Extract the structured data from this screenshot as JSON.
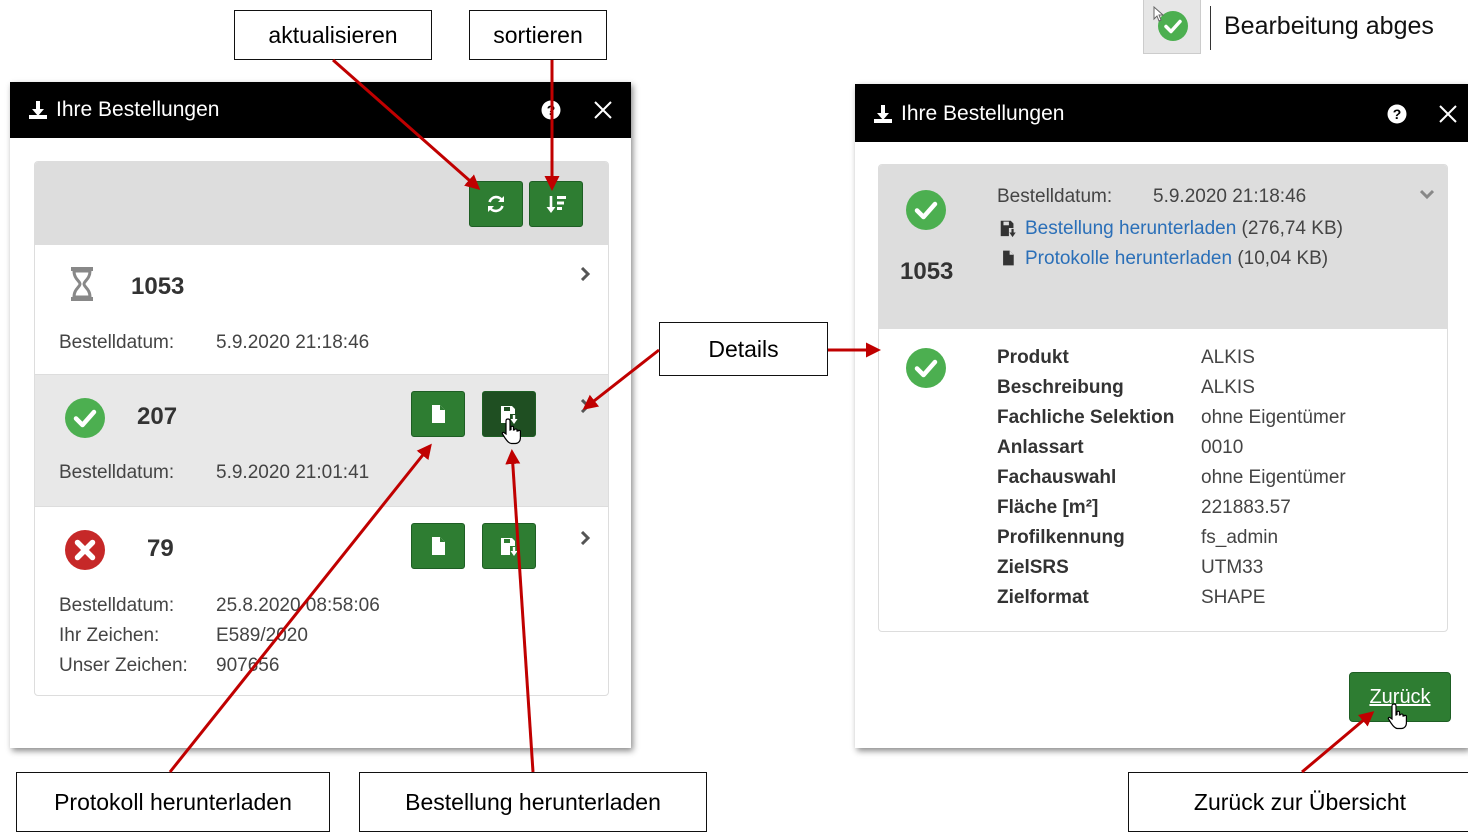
{
  "callouts": {
    "refresh": "aktualisieren",
    "sort": "sortieren",
    "details": "Details",
    "protocol": "Protokoll herunterladen",
    "order": "Bestellung herunterladen",
    "back": "Zurück zur Übersicht",
    "status_done": "Bearbeitung abges"
  },
  "left_panel": {
    "title": "Ihre Bestellungen",
    "items": [
      {
        "number": "1053",
        "status": "pending",
        "date_label": "Bestelldatum:",
        "date": "5.9.2020 21:18:46"
      },
      {
        "number": "207",
        "status": "success",
        "date_label": "Bestelldatum:",
        "date": "5.9.2020 21:01:41"
      },
      {
        "number": "79",
        "status": "error",
        "date_label": "Bestelldatum:",
        "date": "25.8.2020 08:58:06",
        "ref_label": "Ihr Zeichen:",
        "ref": "E589/2020",
        "our_ref_label": "Unser Zeichen:",
        "our_ref": "907656"
      }
    ]
  },
  "right_panel": {
    "title": "Ihre Bestellungen",
    "number": "1053",
    "date_label": "Bestelldatum:",
    "date": "5.9.2020 21:18:46",
    "download_order_link": "Bestellung herunterladen",
    "download_order_size": "(276,74 KB)",
    "download_protocol_link": "Protokolle herunterladen",
    "download_protocol_size": "(10,04 KB)",
    "details": [
      {
        "key": "Produkt",
        "value": "ALKIS"
      },
      {
        "key": "Beschreibung",
        "value": "ALKIS"
      },
      {
        "key": "Fachliche Selektion",
        "value": "ohne Eigentümer"
      },
      {
        "key": "Anlassart",
        "value": "0010"
      },
      {
        "key": "Fachauswahl",
        "value": "ohne Eigentümer"
      },
      {
        "key": "Fläche [m²]",
        "value": "221883.57"
      },
      {
        "key": "Profilkennung",
        "value": "fs_admin"
      },
      {
        "key": "ZielSRS",
        "value": "UTM33"
      },
      {
        "key": "Zielformat",
        "value": "SHAPE"
      }
    ],
    "back_button": "Zurück"
  },
  "icons": {
    "download": "download-icon",
    "help": "question-circle-icon",
    "close": "close-icon",
    "refresh": "refresh-icon",
    "sort": "sort-icon",
    "hourglass": "hourglass-icon",
    "check": "check-circle-icon",
    "error": "x-circle-icon",
    "file": "file-icon",
    "save": "floppy-download-icon",
    "chevron_right": "chevron-right-icon",
    "chevron_down": "chevron-down-icon"
  },
  "colors": {
    "accent_green": "#2e7d32",
    "status_green": "#4caf50",
    "error_red": "#c62828",
    "link_blue": "#2a6fb8",
    "arrow_red": "#c00000"
  }
}
